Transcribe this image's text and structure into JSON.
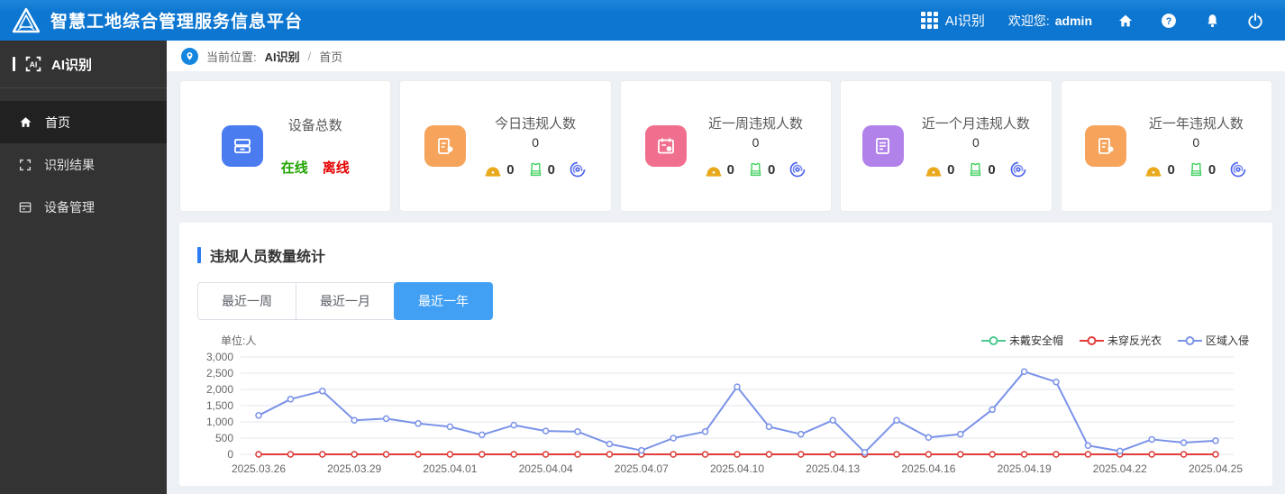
{
  "header": {
    "title": "智慧工地综合管理服务信息平台",
    "nav_app": "AI识别",
    "welcome_label": "欢迎您:",
    "username": "admin"
  },
  "sidebar": {
    "app_title": "AI识别",
    "items": [
      {
        "label": "首页",
        "active": true
      },
      {
        "label": "识别结果",
        "active": false
      },
      {
        "label": "设备管理",
        "active": false
      }
    ]
  },
  "breadcrumb": {
    "prefix": "当前位置:",
    "root": "AI识别",
    "separator": "/",
    "current": "首页"
  },
  "cards": [
    {
      "title": "设备总数",
      "online_label": "在线",
      "offline_label": "离线",
      "color": "#4a7cf0"
    },
    {
      "title": "今日违规人数",
      "value": "0",
      "helmet": "0",
      "vest": "0",
      "color": "#f6a45c"
    },
    {
      "title": "近一周违规人数",
      "value": "0",
      "helmet": "0",
      "vest": "0",
      "color": "#f06f8e"
    },
    {
      "title": "近一个月违规人数",
      "value": "0",
      "helmet": "0",
      "vest": "0",
      "color": "#b183ea"
    },
    {
      "title": "近一年违规人数",
      "value": "0",
      "helmet": "0",
      "vest": "0",
      "color": "#f6a45c"
    }
  ],
  "chart_section": {
    "title": "违规人员数量统计",
    "tabs": [
      {
        "label": "最近一周",
        "active": false
      },
      {
        "label": "最近一月",
        "active": false
      },
      {
        "label": "最近一年",
        "active": true
      }
    ],
    "unit_label": "单位:人"
  },
  "colors": {
    "header_blue": "#0d76d0",
    "tab_active": "#42a0f4",
    "online_green": "#21a300",
    "offline_red": "#e60000",
    "helmet_yellow": "#e9a91c",
    "vest_green": "#47d164",
    "spiral_blue": "#4b63ec"
  },
  "chart_data": {
    "type": "line",
    "title": "违规人员数量统计",
    "ylabel": "单位:人",
    "ylim": [
      0,
      3000
    ],
    "ytick_step": 500,
    "xtick_every": 3,
    "grid": true,
    "legend_position": "top-right",
    "x": [
      "2025.03.26",
      "2025.03.27",
      "2025.03.28",
      "2025.03.29",
      "2025.03.30",
      "2025.03.31",
      "2025.04.01",
      "2025.04.02",
      "2025.04.03",
      "2025.04.04",
      "2025.04.05",
      "2025.04.06",
      "2025.04.07",
      "2025.04.08",
      "2025.04.09",
      "2025.04.10",
      "2025.04.11",
      "2025.04.12",
      "2025.04.13",
      "2025.04.14",
      "2025.04.15",
      "2025.04.16",
      "2025.04.17",
      "2025.04.18",
      "2025.04.19",
      "2025.04.20",
      "2025.04.21",
      "2025.04.22",
      "2025.04.23",
      "2025.04.24",
      "2025.04.25"
    ],
    "series": [
      {
        "name": "未戴安全帽",
        "color": "#4ec88f",
        "values": [
          0,
          0,
          0,
          0,
          0,
          0,
          0,
          0,
          0,
          0,
          0,
          0,
          0,
          0,
          0,
          0,
          0,
          0,
          0,
          0,
          0,
          0,
          0,
          0,
          0,
          0,
          0,
          0,
          0,
          0,
          0
        ]
      },
      {
        "name": "未穿反光衣",
        "color": "#e23c3c",
        "values": [
          0,
          0,
          0,
          0,
          0,
          0,
          0,
          0,
          0,
          0,
          0,
          0,
          0,
          0,
          0,
          0,
          0,
          0,
          0,
          0,
          0,
          0,
          0,
          0,
          0,
          0,
          0,
          0,
          0,
          0,
          0
        ]
      },
      {
        "name": "区域入侵",
        "color": "#7b93e8",
        "values": [
          1200,
          1700,
          1950,
          1050,
          1100,
          950,
          850,
          600,
          900,
          720,
          700,
          320,
          120,
          500,
          700,
          2080,
          850,
          620,
          1050,
          60,
          1050,
          520,
          620,
          1380,
          2550,
          2230,
          270,
          100,
          460,
          360,
          420
        ]
      }
    ]
  }
}
